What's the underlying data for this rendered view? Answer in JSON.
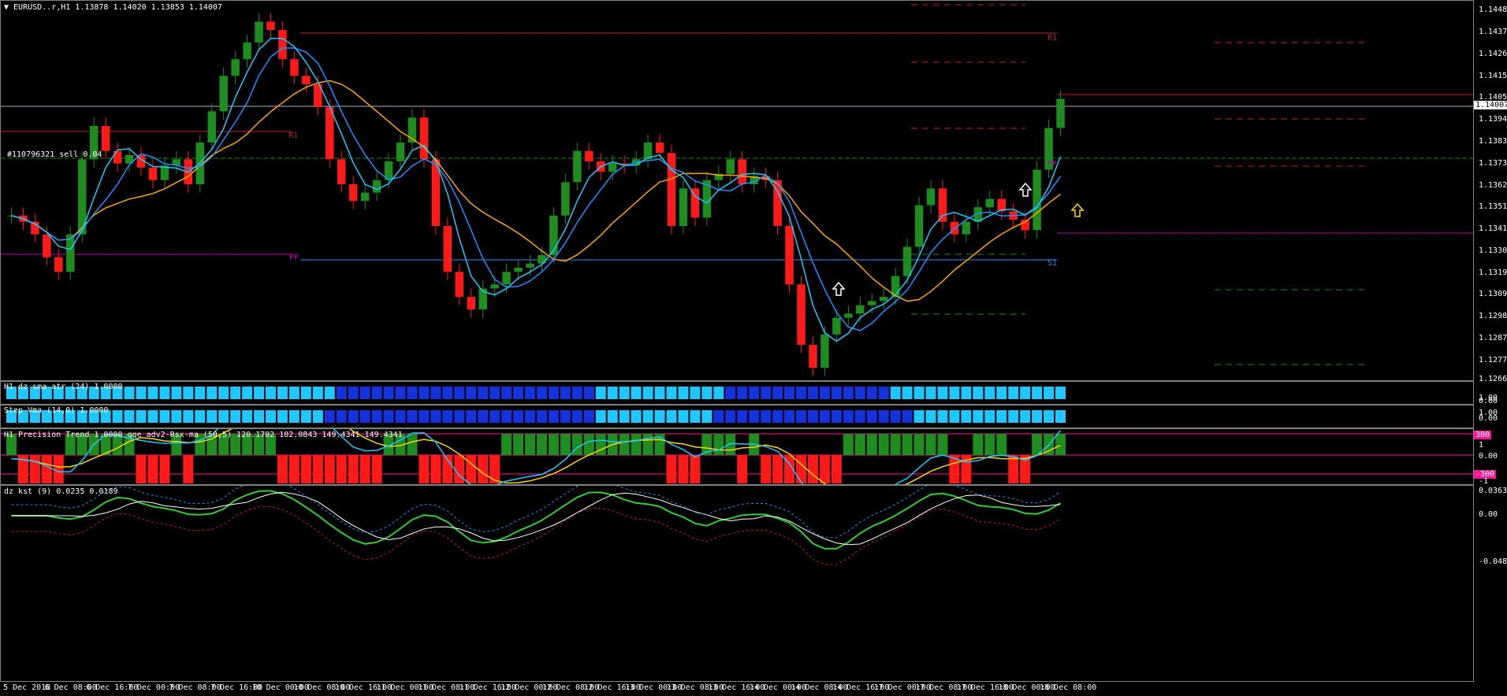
{
  "main": {
    "header": "EURUSD..r,H1  1.13878 1.14020 1.13853 1.14007",
    "order_label": "#110796321 sell 0.04",
    "pivot_labels": [
      "R1",
      "R1",
      "PP",
      "PP",
      "S1"
    ],
    "current_price": "1.14007",
    "price_ticks": [
      "1.14480",
      "1.14370",
      "1.14265",
      "1.14155",
      "1.14050",
      "1.13945",
      "1.13835",
      "1.13730",
      "1.13625",
      "1.13515",
      "1.13410",
      "1.13305",
      "1.13195",
      "1.13090",
      "1.12980",
      "1.12875",
      "1.12770",
      "1.12660"
    ]
  },
  "ind1": {
    "label": "H1 dz sma atr (24) 1.0000",
    "ticks": [
      "1.00",
      "0.00"
    ]
  },
  "ind2": {
    "label": "Step Vma  (14,0) 1.0000",
    "ticks": [
      "1.00",
      "0.00"
    ]
  },
  "ind3": {
    "label": "H1 Precision Trend 1.0000  qqe adv2-Rsx-ma (50,5) 120.1702 102.0843 149.4341 149.4341",
    "ticks": [
      "1",
      "0.00",
      "-1"
    ],
    "badges": [
      "300",
      "-300"
    ]
  },
  "ind4": {
    "label": "dz kst (9) 0.0235 0.0189",
    "ticks": [
      "0.0363",
      "0.00",
      "-0.048"
    ]
  },
  "time_labels": [
    "5 Dec 2018",
    "6 Dec 08:00",
    "6 Dec 16:00",
    "7 Dec 00:00",
    "7 Dec 08:00",
    "7 Dec 16:00",
    "10 Dec 00:00",
    "10 Dec 08:00",
    "10 Dec 16:00",
    "11 Dec 00:00",
    "11 Dec 08:00",
    "11 Dec 16:00",
    "12 Dec 00:00",
    "12 Dec 08:00",
    "12 Dec 16:00",
    "13 Dec 00:00",
    "13 Dec 08:00",
    "13 Dec 16:00",
    "14 Dec 00:00",
    "14 Dec 08:00",
    "14 Dec 16:00",
    "17 Dec 00:00",
    "17 Dec 08:00",
    "17 Dec 16:00",
    "18 Dec 00:00",
    "18 Dec 08:00"
  ],
  "colors": {
    "bull": "#1e8c1e",
    "bear": "#ff1a1a",
    "ma_blue": "#1e90ff",
    "ma_cyan": "#1ec8ff",
    "ma_orange": "#ffa500",
    "pivot_red": "#c0202c",
    "pivot_magenta": "#b400b4"
  },
  "chart_data": {
    "type": "candlestick",
    "symbol": "EURUSD..r",
    "timeframe": "H1",
    "ylim": [
      1.1266,
      1.1448
    ],
    "close": [
      1.1345,
      1.1342,
      1.1336,
      1.1325,
      1.1318,
      1.1336,
      1.1372,
      1.1388,
      1.1376,
      1.137,
      1.1374,
      1.1368,
      1.1362,
      1.1369,
      1.1372,
      1.136,
      1.138,
      1.1395,
      1.1412,
      1.142,
      1.1428,
      1.1438,
      1.1434,
      1.142,
      1.1412,
      1.1408,
      1.1397,
      1.1372,
      1.136,
      1.1352,
      1.1356,
      1.1362,
      1.1371,
      1.138,
      1.1392,
      1.1372,
      1.134,
      1.1318,
      1.1306,
      1.13,
      1.131,
      1.1312,
      1.1318,
      1.132,
      1.1322,
      1.1326,
      1.1345,
      1.1361,
      1.1376,
      1.1371,
      1.1366,
      1.137,
      1.1369,
      1.1372,
      1.138,
      1.1375,
      1.134,
      1.1358,
      1.1344,
      1.1362,
      1.1365,
      1.1372,
      1.136,
      1.1364,
      1.1362,
      1.134,
      1.1312,
      1.1283,
      1.1272,
      1.1288,
      1.1296,
      1.1298,
      1.1302,
      1.1304,
      1.1306,
      1.1316,
      1.133,
      1.135,
      1.1358,
      1.1342,
      1.1336,
      1.1342,
      1.1349,
      1.1353,
      1.1347,
      1.1343,
      1.1338,
      1.1367,
      1.1387,
      1.1401
    ],
    "series": [
      {
        "name": "MA orange",
        "color": "#ffa500"
      },
      {
        "name": "MA blue",
        "color": "#1e90ff"
      },
      {
        "name": "MA cyan",
        "color": "#1ec8ff"
      }
    ]
  }
}
